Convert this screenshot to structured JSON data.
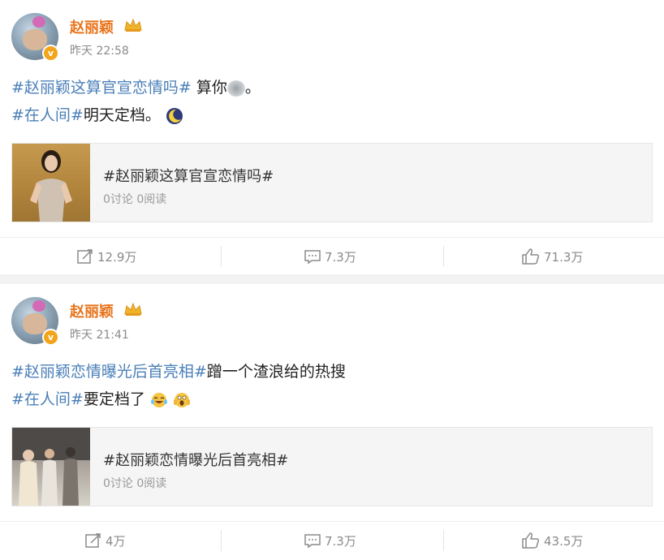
{
  "posts": [
    {
      "author": "赵丽颖",
      "time": "昨天 22:58",
      "line1_tag": "#赵丽颖这算官宣恋情吗#",
      "line1_text": " 算你",
      "line1_after": "。",
      "line2_tag": "#在人间#",
      "line2_text": "明天定档。",
      "card_title": "#赵丽颖这算官宣恋情吗#",
      "card_meta": "0讨论 0阅读",
      "reposts": "12.9万",
      "comments": "7.3万",
      "likes": "71.3万"
    },
    {
      "author": "赵丽颖",
      "time": "昨天 21:41",
      "line1_tag": "#赵丽颖恋情曝光后首亮相#",
      "line1_text": "蹭一个渣浪给的热搜",
      "line2_tag": "#在人间#",
      "line2_text": "要定档了",
      "card_title": "#赵丽颖恋情曝光后首亮相#",
      "card_meta": "0讨论 0阅读",
      "reposts": "4万",
      "comments": "7.3万",
      "likes": "43.5万"
    }
  ],
  "colors": {
    "name": "#e8731a",
    "tag": "#4a7fb8",
    "meta": "#8a8a8a"
  },
  "icons": [
    "crown-icon",
    "verified-badge-icon",
    "repost-icon",
    "comment-icon",
    "like-icon",
    "moon-emoji-icon",
    "laugh-cry-emoji-icon",
    "scream-emoji-icon"
  ]
}
